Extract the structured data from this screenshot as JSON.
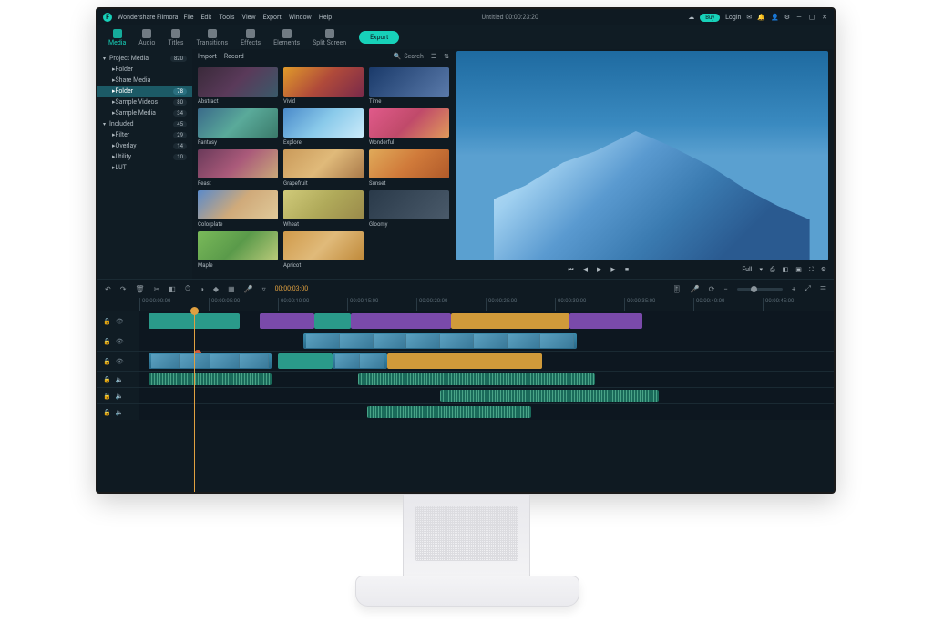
{
  "app": {
    "name": "Wondershare Filmora"
  },
  "menu": [
    "File",
    "Edit",
    "Tools",
    "View",
    "Export",
    "Window",
    "Help"
  ],
  "title_center": "Untitled   00:00:23:20",
  "header_right": {
    "buy": "Buy",
    "login": "Login"
  },
  "tools": [
    {
      "label": "Media",
      "active": true
    },
    {
      "label": "Audio"
    },
    {
      "label": "Titles"
    },
    {
      "label": "Transitions"
    },
    {
      "label": "Effects"
    },
    {
      "label": "Elements"
    },
    {
      "label": "Split Screen"
    }
  ],
  "export_label": "Export",
  "sidebar": {
    "sections": [
      {
        "label": "Project Media",
        "count": "820",
        "caret": "▾",
        "items": [
          {
            "label": "Folder",
            "count": ""
          },
          {
            "label": "Share Media",
            "count": ""
          },
          {
            "label": "Folder",
            "count": "78",
            "selected": true
          },
          {
            "label": "Sample Videos",
            "count": "80"
          },
          {
            "label": "Sample Media",
            "count": "34"
          }
        ]
      },
      {
        "label": "Included",
        "count": "45",
        "caret": "▾",
        "items": [
          {
            "label": "Filter",
            "count": "29"
          },
          {
            "label": "Overlay",
            "count": "14"
          },
          {
            "label": "Utility",
            "count": "10"
          },
          {
            "label": "LUT",
            "count": ""
          }
        ]
      }
    ]
  },
  "media_tabs": [
    "Import",
    "Record"
  ],
  "search_placeholder": "Search",
  "thumbs": [
    {
      "label": "Abstract",
      "g": "g0"
    },
    {
      "label": "Vivid",
      "g": "g1"
    },
    {
      "label": "Time",
      "g": "g2"
    },
    {
      "label": "Fantasy",
      "g": "g3"
    },
    {
      "label": "Explore",
      "g": "g4"
    },
    {
      "label": "Wonderful",
      "g": "g5"
    },
    {
      "label": "Feast",
      "g": "g6"
    },
    {
      "label": "Grapefruit",
      "g": "g7"
    },
    {
      "label": "Sunset",
      "g": "g8"
    },
    {
      "label": "Colorplate",
      "g": "g9"
    },
    {
      "label": "Wheat",
      "g": "g10"
    },
    {
      "label": "Gloomy",
      "g": "g11"
    },
    {
      "label": "Maple",
      "g": "g12"
    },
    {
      "label": "Apricot",
      "g": "g13"
    }
  ],
  "preview": {
    "quality": "Full"
  },
  "ruler": [
    "00:00:00:00",
    "00:00:05:00",
    "00:00:10:00",
    "00:00:15:00",
    "00:00:20:00",
    "00:00:25:00",
    "00:00:30:00",
    "00:00:35:00",
    "00:00:40:00",
    "00:00:45:00"
  ],
  "tl_tools_time": "00:00:03:00"
}
